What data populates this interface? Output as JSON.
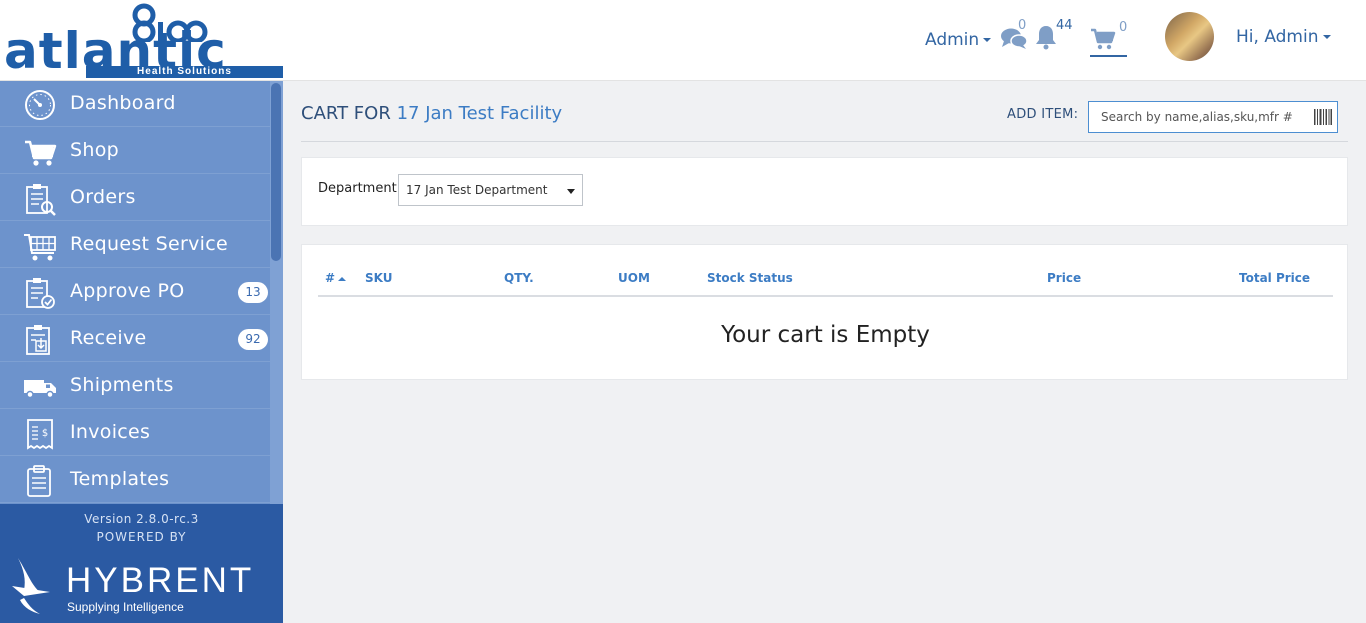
{
  "brand": {
    "logo_word": "atlantic",
    "logo_sub": "Health Solutions"
  },
  "header": {
    "admin_menu_label": "Admin",
    "messages_count": "0",
    "notifications_count": "44",
    "cart_count": "0",
    "greeting": "Hi, Admin"
  },
  "sidebar": {
    "items": [
      {
        "label": "Dashboard",
        "icon": "dashboard-icon"
      },
      {
        "label": "Shop",
        "icon": "shopping-cart-icon"
      },
      {
        "label": "Orders",
        "icon": "orders-clipboard-icon"
      },
      {
        "label": "Request Service",
        "icon": "request-service-cart-icon"
      },
      {
        "label": "Approve PO",
        "icon": "approve-clipboard-icon",
        "badge": "13"
      },
      {
        "label": "Receive",
        "icon": "receive-clipboard-icon",
        "badge": "92"
      },
      {
        "label": "Shipments",
        "icon": "truck-icon"
      },
      {
        "label": "Invoices",
        "icon": "invoice-icon"
      },
      {
        "label": "Templates",
        "icon": "template-icon"
      }
    ],
    "version": "Version 2.8.0-rc.3",
    "powered_by": "POWERED BY",
    "vendor_name": "HYBRENT",
    "vendor_tagline": "Supplying Intelligence"
  },
  "main": {
    "title_prefix": "CART FOR",
    "facility": "17 Jan Test Facility",
    "add_item_label": "ADD ITEM:",
    "search_placeholder": "Search by name,alias,sku,mfr #",
    "department_label": "Department",
    "department_value": "17 Jan Test Department",
    "table_headers": [
      "#",
      "SKU",
      "QTY.",
      "UOM",
      "Stock Status",
      "Price",
      "Total Price"
    ],
    "empty_message": "Your cart is Empty"
  },
  "colors": {
    "sidebar": "#6d93cc",
    "sidebar_footer": "#2b5aa3",
    "accent": "#3c7cc4",
    "brand": "#1f5ea8"
  }
}
